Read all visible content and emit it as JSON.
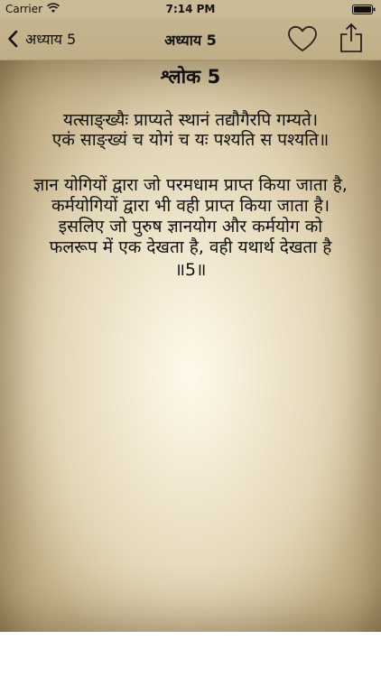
{
  "status_bar": {
    "carrier": "Carrier",
    "time": "7:14 PM"
  },
  "nav": {
    "back_label": "अध्याय 5",
    "title": "अध्याय 5"
  },
  "verse": {
    "title": "श्लोक 5",
    "sanskrit": [
      "यत्साङ्ख्यैः प्राप्यते स्थानं तद्यौगैरपि गम्यते।",
      "एकं साङ्ख्यं च योगं च यः पश्यति स पश्यति॥"
    ],
    "translation": [
      "ज्ञान योगियों द्वारा जो परमधाम प्राप्त किया जाता है,",
      "कर्मयोगियों द्वारा भी वही प्राप्त किया जाता है।",
      "इसलिए जो पुरुष ज्ञानयोग और कर्मयोग को",
      "फलरूप में एक देखता है, वही यथार्थ देखता है",
      "॥5॥"
    ]
  },
  "icons": {
    "back": "chevron-left-icon",
    "favorite": "heart-outline-icon",
    "share": "share-icon",
    "wifi": "wifi-icon",
    "battery": "battery-icon"
  },
  "colors": {
    "nav_bar": "#c6b690",
    "parchment": "#e6d9b8",
    "text": "#111111"
  }
}
